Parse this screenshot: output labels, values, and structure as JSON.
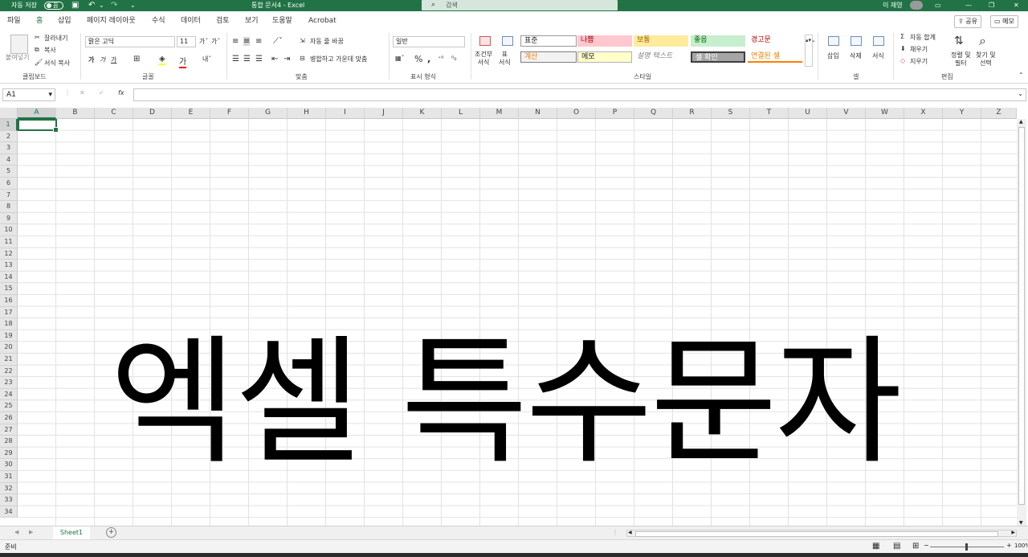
{
  "titlebar": {
    "autosave_label": "자동 저장",
    "toggle_state": "끔",
    "title": "통합 문서4 - Excel",
    "search_placeholder": "검색",
    "user_name": "이 재영"
  },
  "menu": {
    "tabs": [
      "파일",
      "홈",
      "삽입",
      "페이지 레이아웃",
      "수식",
      "데이터",
      "검토",
      "보기",
      "도움말",
      "Acrobat"
    ],
    "active_index": 1,
    "share_label": "공유",
    "memo_label": "메모"
  },
  "ribbon": {
    "clipboard": {
      "paste": "붙여넣기",
      "cut": "잘라내기",
      "copy": "복사",
      "format_painter": "서식 복사",
      "label": "클립보드"
    },
    "font": {
      "name": "맑은 고딕",
      "size": "11",
      "bold": "가",
      "italic": "가",
      "underline": "가",
      "label": "글꼴"
    },
    "alignment": {
      "wrap": "자동 줄 바꿈",
      "merge": "병합하고 가운데 맞춤",
      "label": "맞춤"
    },
    "number": {
      "format": "일반",
      "percent": "%",
      "label": "표시 형식"
    },
    "styles": {
      "conditional": "조건부\n서식",
      "table": "표\n서식",
      "cells": [
        "표준",
        "나쁨",
        "보통",
        "좋음",
        "경고문",
        "계산",
        "메모",
        "설명 텍스트",
        "셀 확인",
        "연결된 셀"
      ],
      "label": "스타일"
    },
    "cells": {
      "insert": "삽입",
      "delete": "삭제",
      "format": "서식",
      "label": "셀"
    },
    "editing": {
      "autosum": "자동 합계",
      "fill": "채우기",
      "clear": "지우기",
      "sort": "정렬 및\n필터",
      "find": "찾기 및\n선택",
      "label": "편집"
    }
  },
  "formula_bar": {
    "name_box": "A1",
    "fx": "fx"
  },
  "grid": {
    "columns": [
      "A",
      "B",
      "C",
      "D",
      "E",
      "F",
      "G",
      "H",
      "I",
      "J",
      "K",
      "L",
      "M",
      "N",
      "O",
      "P",
      "Q",
      "R",
      "S",
      "T",
      "U",
      "V",
      "W",
      "X",
      "Y",
      "Z"
    ],
    "row_count": 34,
    "selected_col": "A",
    "selected_row": 1,
    "overlay_text": "엑셀 특수문자"
  },
  "sheets": {
    "tabs": [
      "Sheet1"
    ],
    "add_label": "+"
  },
  "status": {
    "ready": "준비",
    "zoom": "100%"
  },
  "colors": {
    "accent": "#217346"
  }
}
